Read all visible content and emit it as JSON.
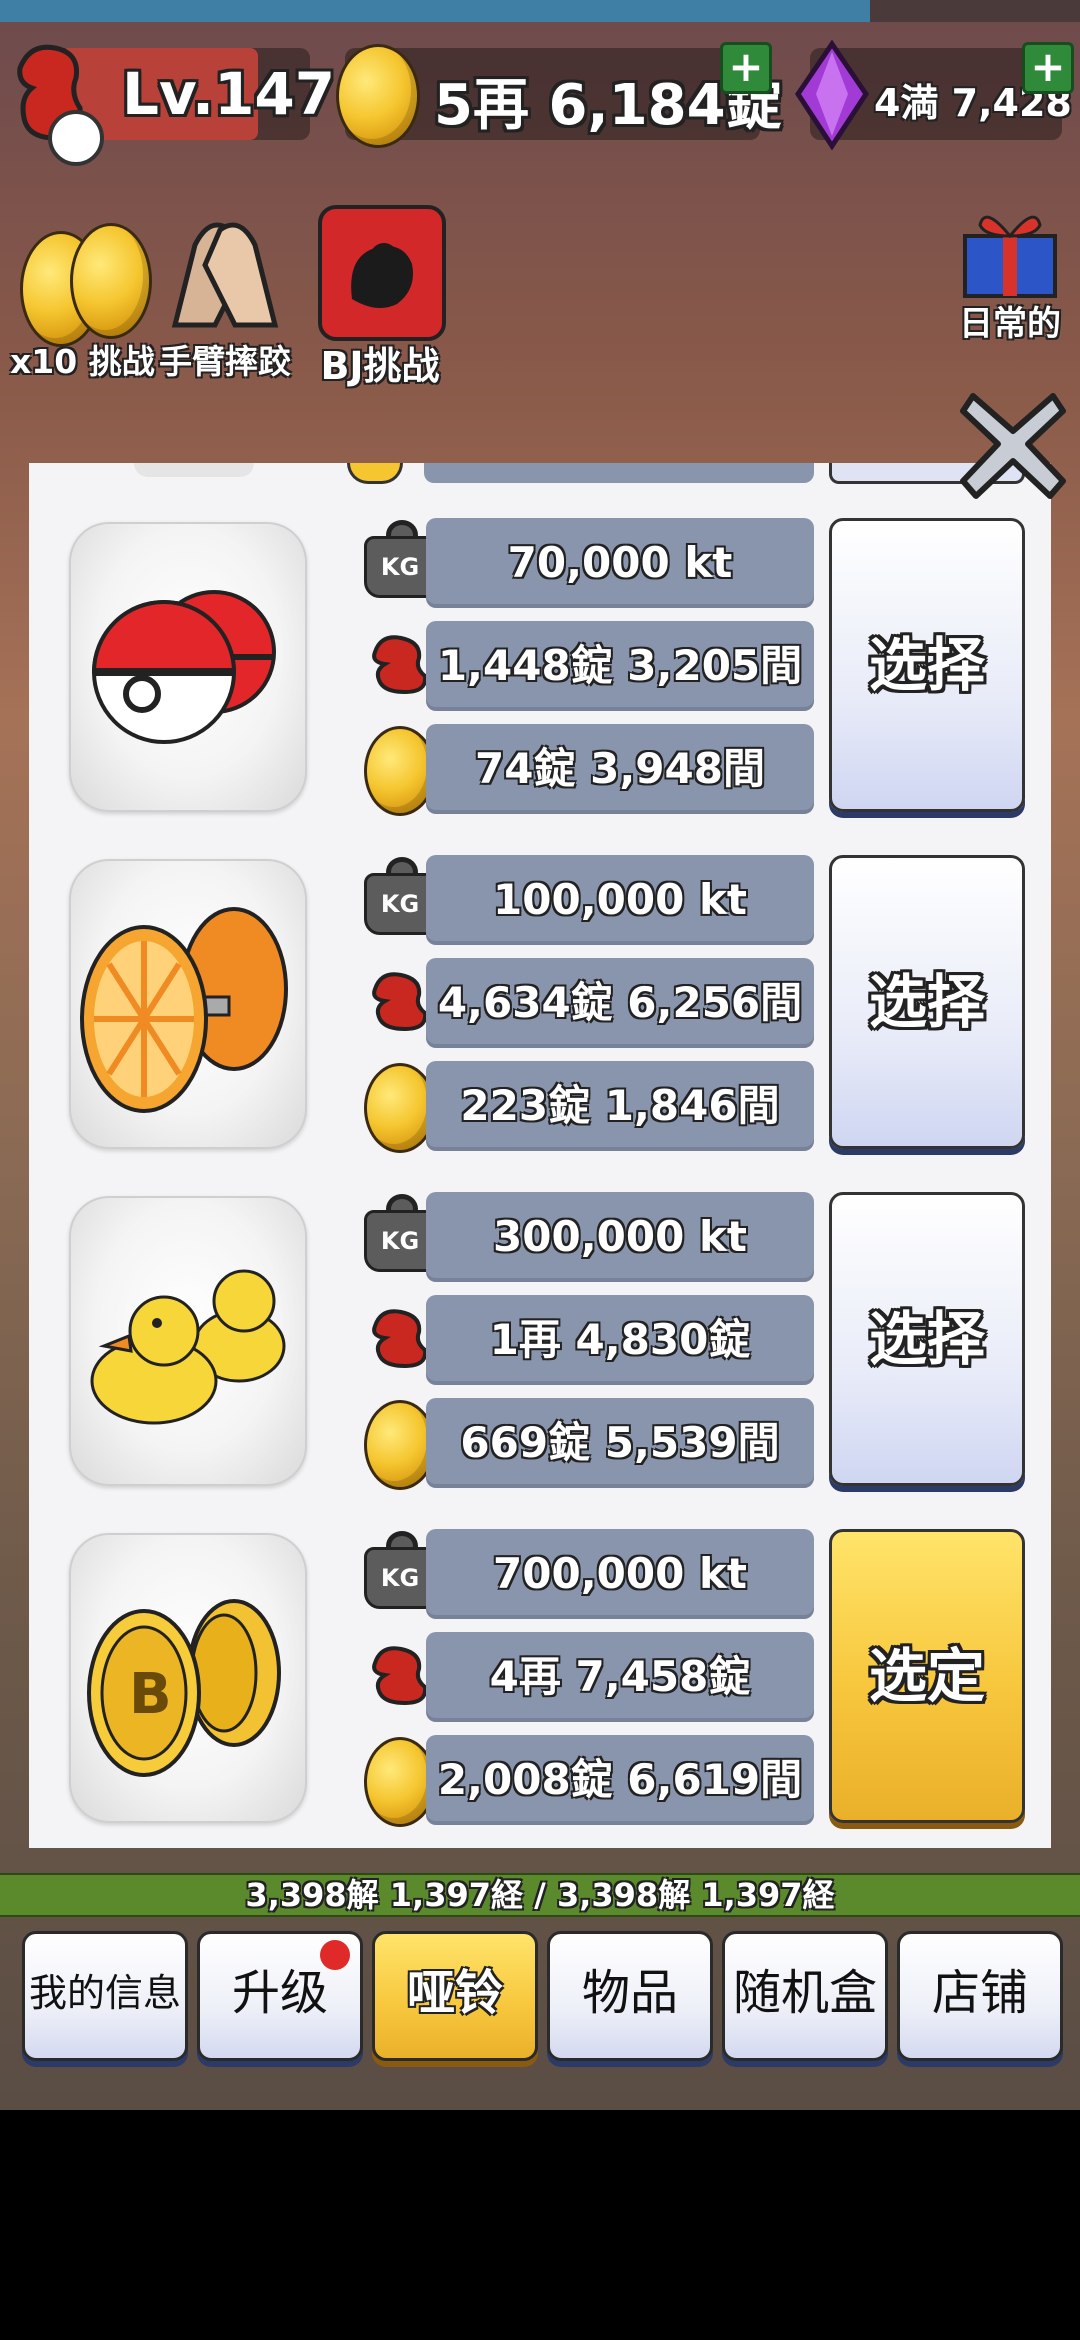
{
  "hud": {
    "level": "Lv.147",
    "gold": "5再 6,184錠",
    "gems": "4満 7,428"
  },
  "quick_actions": [
    {
      "label": "x10 挑战",
      "icon": "coins-icon"
    },
    {
      "label": "手臂摔跤",
      "icon": "arm-wrestle-icon"
    },
    {
      "label": "BJ挑战",
      "icon": "bj-icon"
    }
  ],
  "daily": {
    "label": "日常的"
  },
  "items": [
    {
      "name": "pokeball-dumbbell",
      "weight": "70,000 kt",
      "power": "1,448錠 3,205間",
      "cost": "74錠 3,948間",
      "button": "选择",
      "selected": false
    },
    {
      "name": "orange-dumbbell",
      "weight": "100,000 kt",
      "power": "4,634錠 6,256間",
      "cost": "223錠 1,846間",
      "button": "选择",
      "selected": false
    },
    {
      "name": "duck-dumbbell",
      "weight": "300,000 kt",
      "power": "1再 4,830錠",
      "cost": "669錠 5,539間",
      "button": "选择",
      "selected": false
    },
    {
      "name": "bitcoin-dumbbell",
      "weight": "700,000 kt",
      "power": "4再 7,458錠",
      "cost": "2,008錠 6,619間",
      "button": "选定",
      "selected": true
    }
  ],
  "kg_label": "KG",
  "progress": {
    "text": "3,398解 1,397経 / 3,398解 1,397経",
    "fraction": 1.0
  },
  "tabs": [
    {
      "label": "我的信息",
      "active": false,
      "badge": false
    },
    {
      "label": "升级",
      "active": false,
      "badge": true
    },
    {
      "label": "哑铃",
      "active": true,
      "badge": false
    },
    {
      "label": "物品",
      "active": false,
      "badge": false
    },
    {
      "label": "随机盒",
      "active": false,
      "badge": false
    },
    {
      "label": "店铺",
      "active": false,
      "badge": false
    }
  ],
  "colors": {
    "stat_bg": "#8895ad",
    "selected_btn": "#f7c63c",
    "progress": "#5a8a2c"
  }
}
